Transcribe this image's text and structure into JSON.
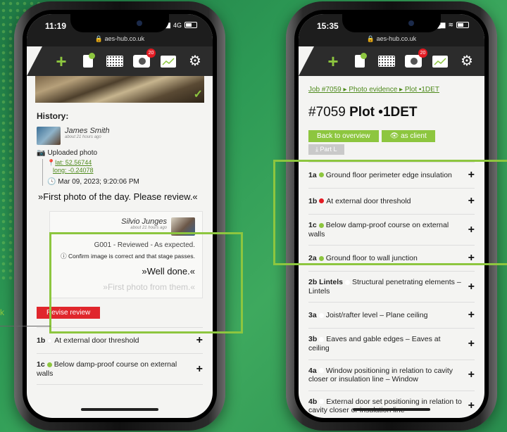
{
  "left_phone": {
    "time": "11:19",
    "network": "4G",
    "url": "aes-hub.co.uk",
    "badge": "20",
    "history_title": "History:",
    "user1": {
      "name": "James Smith",
      "ago": "about 21 hours ago"
    },
    "uploaded": "Uploaded photo",
    "lat": "lat: 52.56744",
    "long": "long: -0.24078",
    "timestamp": "Mar 09, 2023; 9:20:06 PM",
    "quote": "»First photo of the day. Please review.«",
    "user2": {
      "name": "Silvio Junges",
      "ago": "about 21 hours ago"
    },
    "review_line": "G001 - Reviewed - As expected.",
    "confirm_line": "Confirm image is correct and that stage passes.",
    "well_done": "»Well done.«",
    "faded_quote": "»First photo from them.«",
    "revise_button": "Revise review",
    "rows": [
      {
        "code": "1b",
        "dot": "#ffffff",
        "text": "At external door threshold"
      },
      {
        "code": "1c",
        "dot": "#8dc63f",
        "text": "Below damp-proof course on external walls"
      }
    ]
  },
  "right_phone": {
    "time": "15:35",
    "url": "aes-hub.co.uk",
    "badge": "20",
    "breadcrumb": [
      "Job #7059",
      "Photo evidence",
      "Plot •1DET"
    ],
    "job_number": "#7059",
    "plot": "Plot •1DET",
    "back_button": "Back to overview",
    "client_button": "as client",
    "part_button": "Part L",
    "rows": [
      {
        "code": "1a",
        "dot": "#8dc63f",
        "text": "Ground floor perimeter edge insulation"
      },
      {
        "code": "1b",
        "dot": "#e31b23",
        "text": "At external door threshold"
      },
      {
        "code": "1c",
        "dot": "#8dc63f",
        "text": "Below damp-proof course on external walls"
      },
      {
        "code": "2a",
        "dot": "#8dc63f",
        "text": "Ground floor to wall junction"
      },
      {
        "code": "2b Lintels",
        "dot": "#ffffff",
        "text": "Structural penetrating elements – Lintels"
      },
      {
        "code": "3a",
        "dot": "#ffffff",
        "text": "Joist/rafter level – Plane ceiling"
      },
      {
        "code": "3b",
        "dot": "#ffffff",
        "text": "Eaves and gable edges – Eaves at ceiling"
      },
      {
        "code": "4a",
        "dot": "#ffffff",
        "text": "Window positioning in relation to cavity closer or insulation line – Window"
      },
      {
        "code": "4b",
        "dot": "#ffffff",
        "text": "External door set positioning in relation to cavity closer or insulation line"
      }
    ]
  },
  "callout_label": "k",
  "colors": {
    "accent": "#8dc63f",
    "alert": "#e31b23",
    "toolbar": "#2c2c2c"
  }
}
